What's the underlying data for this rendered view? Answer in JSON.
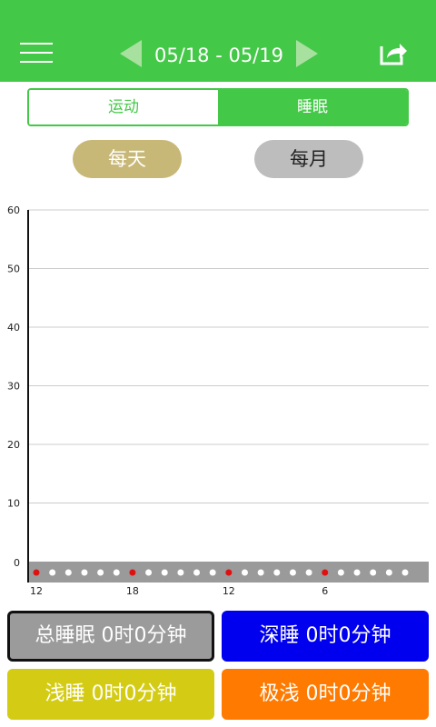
{
  "header": {
    "date_range": "05/18 - 05/19"
  },
  "tabs": [
    {
      "label": "运动",
      "active": false
    },
    {
      "label": "睡眠",
      "active": true
    }
  ],
  "period": {
    "daily_label": "每天",
    "monthly_label": "每月",
    "selected": "daily"
  },
  "chart_data": {
    "type": "scatter",
    "y_ticks": [
      "0",
      "10",
      "20",
      "30",
      "40",
      "50",
      "60"
    ],
    "ylim": [
      0,
      60
    ],
    "x_tick_labels": [
      "12",
      "18",
      "12",
      "6"
    ],
    "grid": true,
    "timeline_dot_count": 24,
    "highlighted_dots": [
      0,
      6,
      12,
      18
    ],
    "values": [],
    "colors": {
      "highlight_dot": "#e01010",
      "normal_dot": "#ffffff",
      "band": "#9a9a9a",
      "grid": "#cccccc"
    }
  },
  "stats": {
    "total": "总睡眠 0时0分钟",
    "deep": "深睡 0时0分钟",
    "light": "浅睡 0时0分钟",
    "ultra_light": "极浅 0时0分钟"
  },
  "colors": {
    "brand_green": "#44c848",
    "total_bg": "#9b9b9b",
    "deep_bg": "#0000ee",
    "light_bg": "#d4cc14",
    "ultra_bg": "#ff7a00",
    "daily_pill": "#c8b878",
    "monthly_pill": "#bdbdbd"
  },
  "icons": {
    "menu": "menu-icon",
    "prev": "chevron-left-icon",
    "next": "chevron-right-icon",
    "share": "share-icon"
  }
}
